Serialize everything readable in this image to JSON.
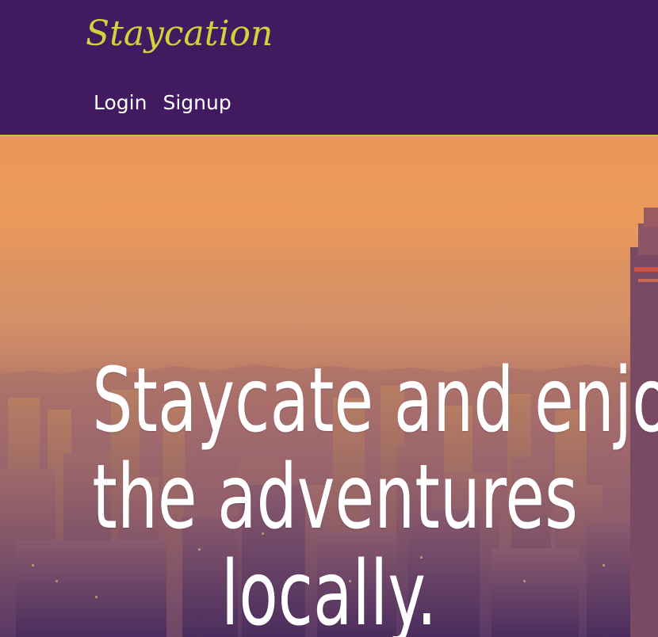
{
  "header": {
    "brand": "Staycation",
    "nav": [
      {
        "label": "Login"
      },
      {
        "label": "Signup"
      }
    ]
  },
  "hero": {
    "headline_lines": [
      "Staycate and enjoy",
      "the adventures",
      "locally."
    ]
  },
  "colors": {
    "header_bg": "#411a5f",
    "brand": "#d0d33a",
    "header_border": "#c9c23a",
    "nav_text": "#ffffff",
    "headline": "#ffffff"
  }
}
